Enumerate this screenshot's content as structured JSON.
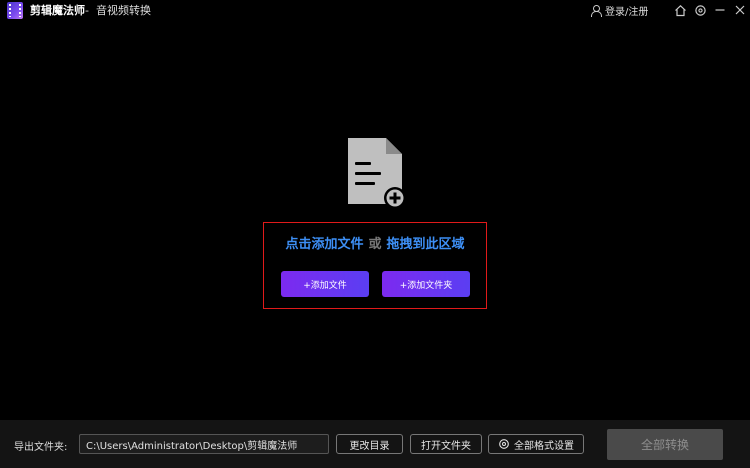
{
  "titlebar": {
    "app_name": "剪辑魔法师",
    "separator": "-",
    "subtitle": "音视频转换",
    "login_label": "登录/注册",
    "icons": [
      "user-icon",
      "home-icon",
      "settings-icon",
      "minimize-icon",
      "close-icon"
    ]
  },
  "main": {
    "drop_hint": {
      "click_add": "点击添加文件",
      "or": "或",
      "drag_here": "拖拽到此区域"
    },
    "add_file_label": "+添加文件",
    "add_folder_label": "+添加文件夹",
    "icon": "file-add-icon",
    "highlight_color": "#e01a1a",
    "accent_color": "#3d8ff5"
  },
  "bottombar": {
    "export_label": "导出文件夹:",
    "path_value": "C:\\Users\\Administrator\\Desktop\\剪辑魔法师",
    "change_dir_label": "更改目录",
    "open_folder_label": "打开文件夹",
    "format_settings_label": "全部格式设置",
    "convert_all_label": "全部转换"
  }
}
